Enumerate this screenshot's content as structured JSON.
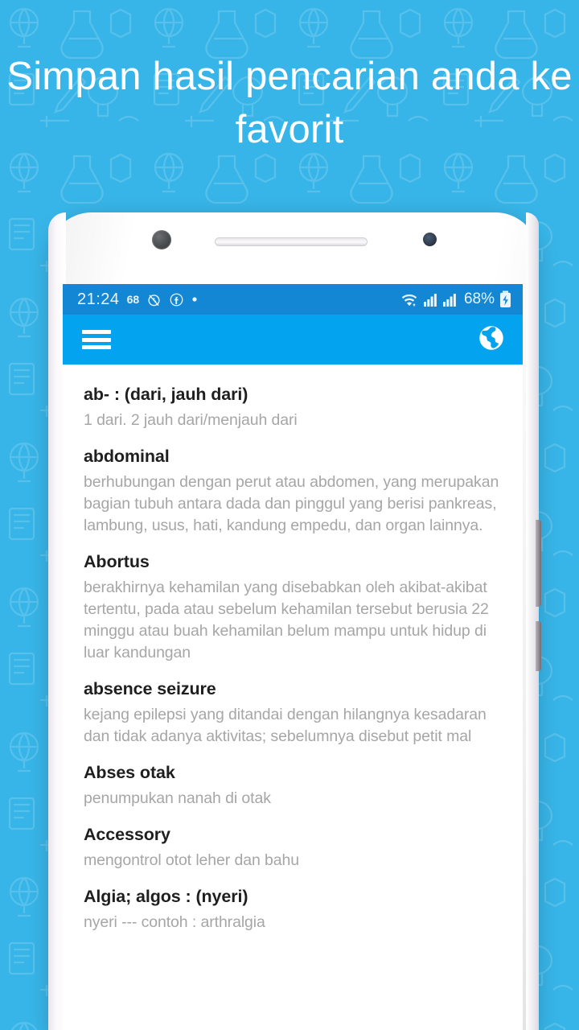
{
  "promo": {
    "headline": "Simpan hasil pencarian anda ke favorit",
    "background_color": "#38b5e8",
    "headline_color": "#ffffff"
  },
  "status_bar": {
    "time": "21:24",
    "notification_count": "68",
    "icons_left": [
      "alarm-off-icon",
      "facebook-icon",
      "dot-icon"
    ],
    "icons_right": [
      "wifi-icon",
      "signal-sim1-icon",
      "signal-sim2-icon"
    ],
    "battery_percent": "68%",
    "battery_state": "charging",
    "background_color": "#1386d4"
  },
  "app_bar": {
    "menu_icon": "hamburger-menu-icon",
    "language_icon": "globe-icon",
    "background_color": "#03a3f0"
  },
  "dictionary": {
    "entries": [
      {
        "term": "ab- : (dari, jauh dari)",
        "definition": "1 dari. 2 jauh dari/menjauh dari"
      },
      {
        "term": "abdominal",
        "definition": "berhubungan dengan perut atau abdomen, yang merupakan bagian tubuh antara dada dan pinggul yang berisi pankreas, lambung, usus, hati, kandung empedu, dan organ lainnya."
      },
      {
        "term": "Abortus",
        "definition": "berakhirnya kehamilan yang disebabkan oleh akibat-akibat tertentu, pada atau sebelum kehamilan tersebut berusia 22 minggu atau buah kehamilan belum mampu untuk hidup di luar kandungan"
      },
      {
        "term": "absence seizure",
        "definition": "kejang epilepsi yang ditandai dengan hilangnya kesadaran dan tidak adanya aktivitas; sebelumnya disebut petit mal"
      },
      {
        "term": "Abses otak",
        "definition": "penumpukan nanah di otak"
      },
      {
        "term": "Accessory",
        "definition": "mengontrol otot leher dan bahu"
      },
      {
        "term": "Algia; algos : (nyeri)",
        "definition": "nyeri --- contoh : arthralgia"
      }
    ]
  },
  "device": {
    "camera": "front-camera",
    "speaker": "earpiece-speaker",
    "sensor": "proximity-sensor",
    "buttons": [
      "volume-rocker",
      "power-button"
    ]
  }
}
